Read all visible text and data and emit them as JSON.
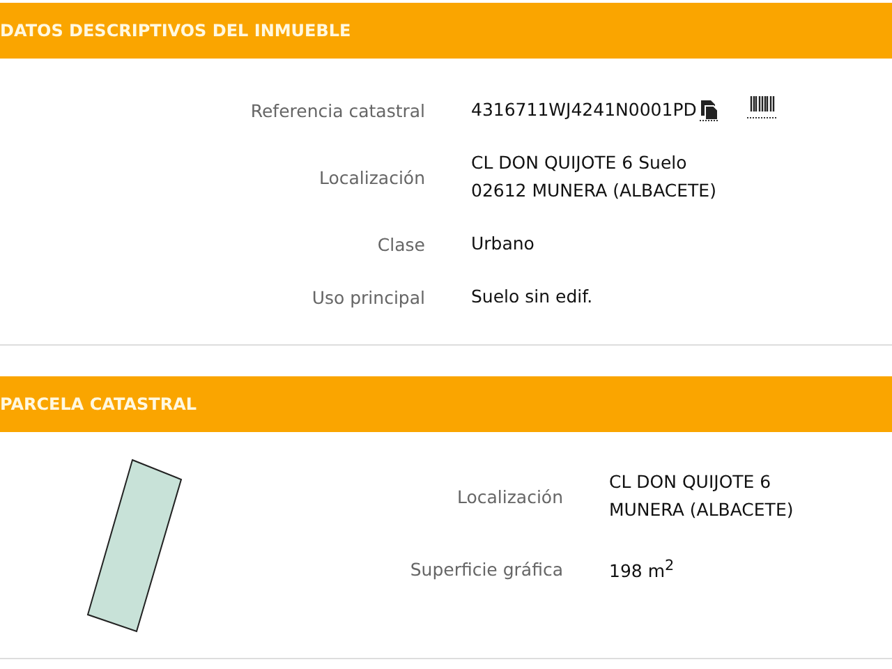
{
  "sections": [
    {
      "title": "DATOS DESCRIPTIVOS DEL INMUEBLE",
      "kind": "plain",
      "rows": [
        {
          "kind": "reference",
          "label": "Referencia catastral",
          "lines": [
            "4316711WJ4241N0001PD"
          ]
        },
        {
          "kind": "text",
          "label": "Localización",
          "lines": [
            "CL DON QUIJOTE 6 Suelo",
            "02612 MUNERA (ALBACETE)"
          ]
        },
        {
          "kind": "text",
          "label": "Clase",
          "lines": [
            "Urbano"
          ]
        },
        {
          "kind": "text",
          "label": "Uso principal",
          "lines": [
            "Suelo sin edif."
          ]
        }
      ]
    },
    {
      "title": "PARCELA CATASTRAL",
      "kind": "parcel",
      "rows": [
        {
          "kind": "text",
          "label": "Localización",
          "lines": [
            "CL DON QUIJOTE 6",
            "MUNERA (ALBACETE)"
          ]
        },
        {
          "kind": "text",
          "label": "Superficie gráfica",
          "lines": [
            "198 m$^{2}$"
          ]
        }
      ]
    }
  ]
}
